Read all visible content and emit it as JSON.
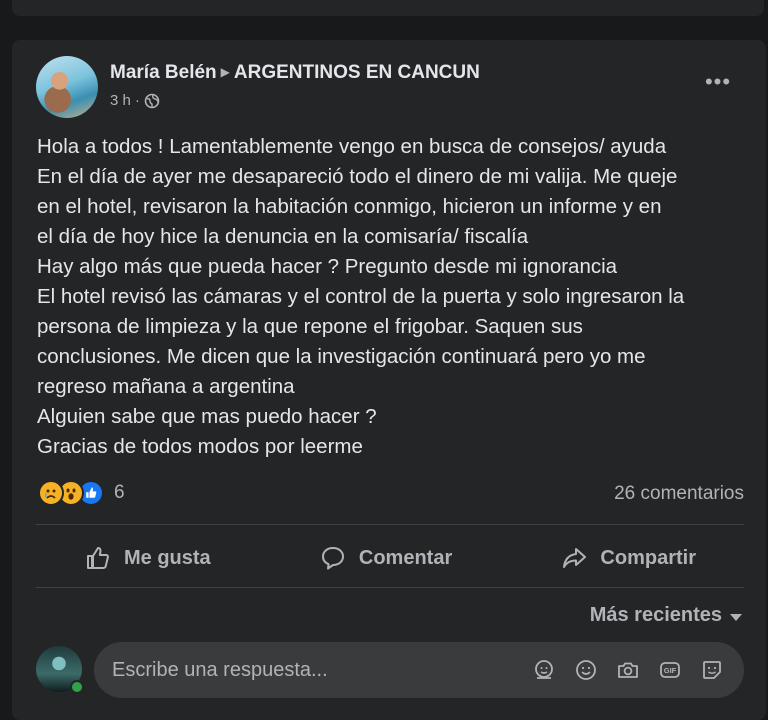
{
  "post": {
    "author": "María Belén",
    "group": "ARGENTINOS EN CANCUN",
    "time": "3 h",
    "more_label": "•••",
    "text_lines": [
      "Hola a todos ! Lamentablemente vengo en busca de consejos/ ayuda",
      "En el día de ayer me desapareció todo el dinero de mi valija. Me queje",
      "en el hotel, revisaron la habitación conmigo, hicieron un informe y en",
      "el día de hoy hice la denuncia en la comisaría/ fiscalía",
      "Hay algo más que pueda hacer ? Pregunto desde mi ignorancia",
      "El hotel revisó las cámaras y el control de la puerta y solo ingresaron la",
      "persona de limpieza y la que repone el frigobar. Saquen sus",
      "conclusiones. Me dicen que la investigación continuará pero yo me",
      "regreso mañana a argentina",
      "Alguien sabe que mas puedo hacer ?",
      "Gracias de todos modos por leerme"
    ]
  },
  "reactions": {
    "icons": [
      "sad-reaction-icon",
      "wow-reaction-icon",
      "like-reaction-icon"
    ],
    "count": "6"
  },
  "comments_count": "26 comentarios",
  "actions": {
    "like": "Me gusta",
    "comment": "Comentar",
    "share": "Compartir"
  },
  "sort_label": "Más recientes",
  "reply": {
    "placeholder": "Escribe una respuesta...",
    "icons": [
      "avatar-sticker-icon",
      "emoji-icon",
      "camera-icon",
      "gif-icon",
      "sticker-icon"
    ]
  },
  "colors": {
    "background": "#18191a",
    "card": "#242526",
    "text_primary": "#e4e6eb",
    "text_secondary": "#b0b3b8",
    "input_bg": "#3a3b3c",
    "like_blue": "#1877f2",
    "online_green": "#31a24c"
  }
}
